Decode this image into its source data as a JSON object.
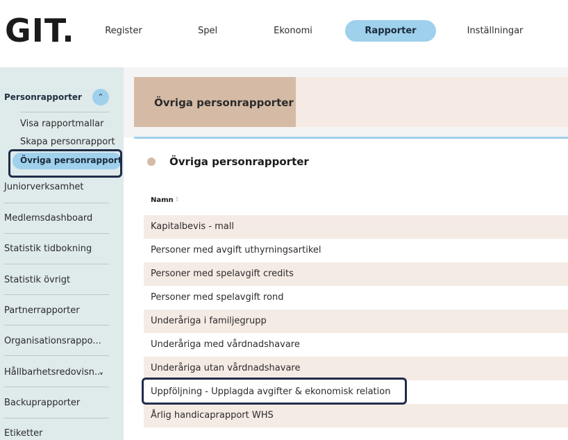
{
  "brand": {
    "logo": "GIT."
  },
  "nav": {
    "items": [
      {
        "label": "Register"
      },
      {
        "label": "Spel"
      },
      {
        "label": "Ekonomi"
      },
      {
        "label": "Rapporter",
        "active": true
      },
      {
        "label": "Inställningar"
      }
    ]
  },
  "sidebar": {
    "section_title": "Personrapporter",
    "collapse_icon": "chevron-up-icon",
    "sub_items": [
      {
        "label": "Visa rapportmallar"
      },
      {
        "label": "Skapa personrapport"
      },
      {
        "label": "Övriga personrapporter",
        "active": true
      }
    ],
    "items": [
      {
        "label": "Juniorverksamhet"
      },
      {
        "label": "Medlemsdashboard"
      },
      {
        "label": "Statistik tidbokning"
      },
      {
        "label": "Statistik övrigt"
      },
      {
        "label": "Partnerrapporter"
      },
      {
        "label": "Organisationsrappo..."
      },
      {
        "label": "Hållbarhetsredovisn...",
        "expand_icon": "chevron-down-icon"
      },
      {
        "label": "Backuprapporter"
      },
      {
        "label": "Etiketter"
      }
    ]
  },
  "main": {
    "tab_label": "Övriga personrapporter",
    "card_title": "Övriga personrapporter",
    "table": {
      "column_header": "Namn",
      "sort_icon": "sort-icon",
      "rows": [
        "Kapitalbevis - mall",
        "Personer med avgift uthyrningsartikel",
        "Personer med spelavgift credits",
        "Personer med spelavgift rond",
        "Underåriga i familjegrupp",
        "Underåriga med vårdnadshavare",
        "Underåriga utan vårdnadshavare",
        "Uppföljning - Upplagda avgifter & ekonomisk relation",
        "Årlig handicaprapport WHS"
      ]
    }
  },
  "colors": {
    "accent": "#9fd0ec",
    "tab_active": "#d5bba5",
    "row_alt": "#f5ebe5",
    "sidebar_bg": "#dfeaeb",
    "highlight_border": "#1f2d4a"
  }
}
